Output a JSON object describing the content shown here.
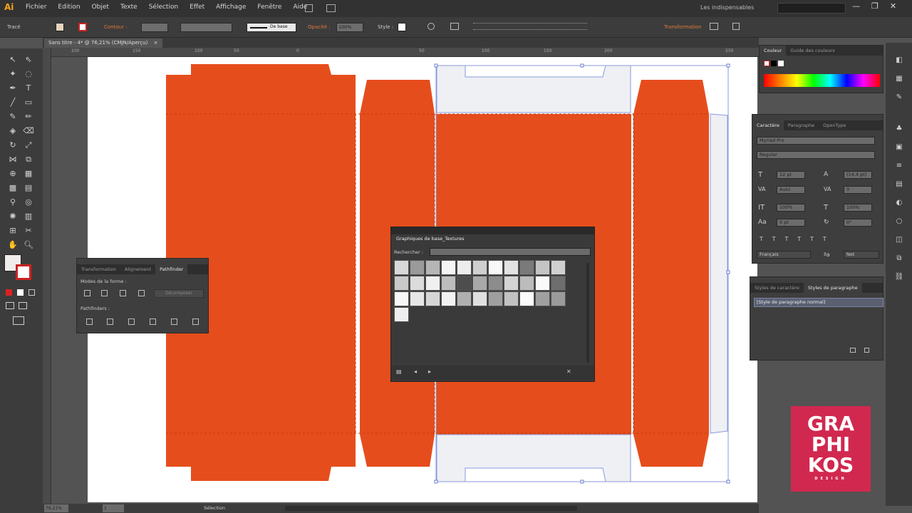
{
  "app": {
    "logo_text": "Ai",
    "workspace": "Les indispensables",
    "window_buttons": [
      "—",
      "❐",
      "✕"
    ]
  },
  "menu": [
    "Fichier",
    "Edition",
    "Objet",
    "Texte",
    "Sélection",
    "Effet",
    "Affichage",
    "Fenêtre",
    "Aide"
  ],
  "controlbar": {
    "tool_label": "Tracé",
    "contour_label": "Contour :",
    "stroke_style": "De base",
    "opacity_label": "Opacité :",
    "opacity_value": "100%",
    "style_label": "Style :",
    "transform_label": "Transformation"
  },
  "document": {
    "tab_title": "Sans titre - 4* @ 76,21% (CMJN/Aperçu)",
    "tab_close": "×"
  },
  "ruler_top": [
    "200",
    "150",
    "100",
    "50",
    "0",
    "50",
    "100",
    "150",
    "200",
    "250"
  ],
  "status": {
    "zoom": "76,21%",
    "page": "1",
    "mode": "Sélection"
  },
  "colors": {
    "accent_orange": "#e64d1c",
    "box_light": "#eef0f4",
    "selection_blue": "#8a9adf",
    "logo_bg": "#d1284f"
  },
  "pathfinder": {
    "tabs": [
      "Transformation",
      "Alignement",
      "Pathfinder"
    ],
    "shape_modes_label": "Modes de la forme :",
    "expand_button": "Décomposer",
    "pathfinders_label": "Pathfinders :"
  },
  "couleur": {
    "tabs": [
      "Couleur",
      "Guide des couleurs"
    ]
  },
  "caractere": {
    "tabs": [
      "Caractère",
      "Paragraphe",
      "OpenType"
    ],
    "font": "Myriad Pro",
    "style": "Regular",
    "size": "12 pt",
    "leading": "(14,4 pt)",
    "kerning": "Auto",
    "tracking": "0",
    "vscale": "100%",
    "hscale": "100%",
    "baseline": "0 pt",
    "rotation": "0°",
    "language": "Français",
    "aa": "Net"
  },
  "styles_panel": {
    "tabs": [
      "Styles de caractère",
      "Styles de paragraphe"
    ],
    "item": "[Style de paragraphe normal]"
  },
  "graphiques": {
    "title": "Graphiques de base_Textures",
    "search_label": "Rechercher :",
    "search_value": ""
  },
  "logo": {
    "line1": "GRA",
    "line2": "PHI",
    "line3": "KOS",
    "sub": "DESIGN"
  }
}
